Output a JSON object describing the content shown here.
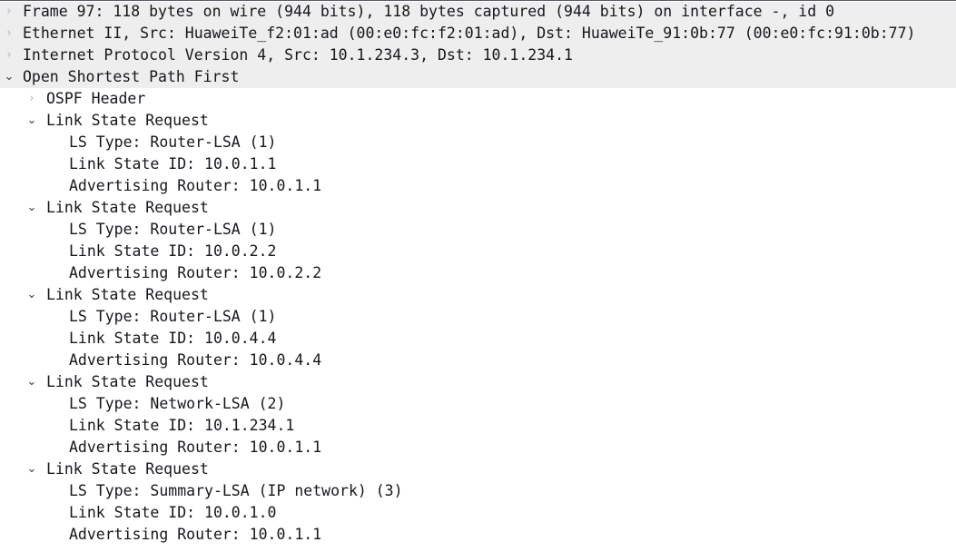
{
  "pane": {
    "name": "Packet details tree",
    "highlight_color": "#eeeeee",
    "text_color": "#16161d",
    "twisty_collapsed_glyph": "›",
    "twisty_expanded_glyph": "⌄"
  },
  "tree": [
    {
      "level": 1,
      "state": "collapsed",
      "icon": "chevron-right-icon",
      "name": "frame-row",
      "label": "Frame 97: 118 bytes on wire (944 bits), 118 bytes captured (944 bits) on interface -, id 0"
    },
    {
      "level": 1,
      "state": "collapsed",
      "icon": "chevron-right-icon",
      "name": "ethernet-row",
      "label": "Ethernet II, Src: HuaweiTe_f2:01:ad (00:e0:fc:f2:01:ad), Dst: HuaweiTe_91:0b:77 (00:e0:fc:91:0b:77)"
    },
    {
      "level": 1,
      "state": "collapsed",
      "icon": "chevron-right-icon",
      "name": "ipv4-row",
      "label": "Internet Protocol Version 4, Src: 10.1.234.3, Dst: 10.1.234.1"
    },
    {
      "level": 1,
      "state": "expanded",
      "icon": "chevron-down-icon",
      "name": "ospf-row",
      "label": "Open Shortest Path First"
    },
    {
      "level": 2,
      "state": "collapsed",
      "icon": "chevron-right-icon",
      "name": "ospf-header-row",
      "label": "OSPF Header"
    },
    {
      "level": 2,
      "state": "expanded",
      "icon": "chevron-down-icon",
      "name": "link-state-request-row",
      "label": "Link State Request"
    },
    {
      "level": 3,
      "state": "leaf",
      "icon": "none",
      "name": "ls-type-field",
      "label": "LS Type: Router-LSA (1)"
    },
    {
      "level": 3,
      "state": "leaf",
      "icon": "none",
      "name": "link-state-id-field",
      "label": "Link State ID: 10.0.1.1"
    },
    {
      "level": 3,
      "state": "leaf",
      "icon": "none",
      "name": "advertising-router-field",
      "label": "Advertising Router: 10.0.1.1"
    },
    {
      "level": 2,
      "state": "expanded",
      "icon": "chevron-down-icon",
      "name": "link-state-request-row",
      "label": "Link State Request"
    },
    {
      "level": 3,
      "state": "leaf",
      "icon": "none",
      "name": "ls-type-field",
      "label": "LS Type: Router-LSA (1)"
    },
    {
      "level": 3,
      "state": "leaf",
      "icon": "none",
      "name": "link-state-id-field",
      "label": "Link State ID: 10.0.2.2"
    },
    {
      "level": 3,
      "state": "leaf",
      "icon": "none",
      "name": "advertising-router-field",
      "label": "Advertising Router: 10.0.2.2"
    },
    {
      "level": 2,
      "state": "expanded",
      "icon": "chevron-down-icon",
      "name": "link-state-request-row",
      "label": "Link State Request"
    },
    {
      "level": 3,
      "state": "leaf",
      "icon": "none",
      "name": "ls-type-field",
      "label": "LS Type: Router-LSA (1)"
    },
    {
      "level": 3,
      "state": "leaf",
      "icon": "none",
      "name": "link-state-id-field",
      "label": "Link State ID: 10.0.4.4"
    },
    {
      "level": 3,
      "state": "leaf",
      "icon": "none",
      "name": "advertising-router-field",
      "label": "Advertising Router: 10.0.4.4"
    },
    {
      "level": 2,
      "state": "expanded",
      "icon": "chevron-down-icon",
      "name": "link-state-request-row",
      "label": "Link State Request"
    },
    {
      "level": 3,
      "state": "leaf",
      "icon": "none",
      "name": "ls-type-field",
      "label": "LS Type: Network-LSA (2)"
    },
    {
      "level": 3,
      "state": "leaf",
      "icon": "none",
      "name": "link-state-id-field",
      "label": "Link State ID: 10.1.234.1"
    },
    {
      "level": 3,
      "state": "leaf",
      "icon": "none",
      "name": "advertising-router-field",
      "label": "Advertising Router: 10.0.1.1"
    },
    {
      "level": 2,
      "state": "expanded",
      "icon": "chevron-down-icon",
      "name": "link-state-request-row",
      "label": "Link State Request"
    },
    {
      "level": 3,
      "state": "leaf",
      "icon": "none",
      "name": "ls-type-field",
      "label": "LS Type: Summary-LSA (IP network) (3)"
    },
    {
      "level": 3,
      "state": "leaf",
      "icon": "none",
      "name": "link-state-id-field",
      "label": "Link State ID: 10.0.1.0"
    },
    {
      "level": 3,
      "state": "leaf",
      "icon": "none",
      "name": "advertising-router-field",
      "label": "Advertising Router: 10.0.1.1"
    }
  ]
}
